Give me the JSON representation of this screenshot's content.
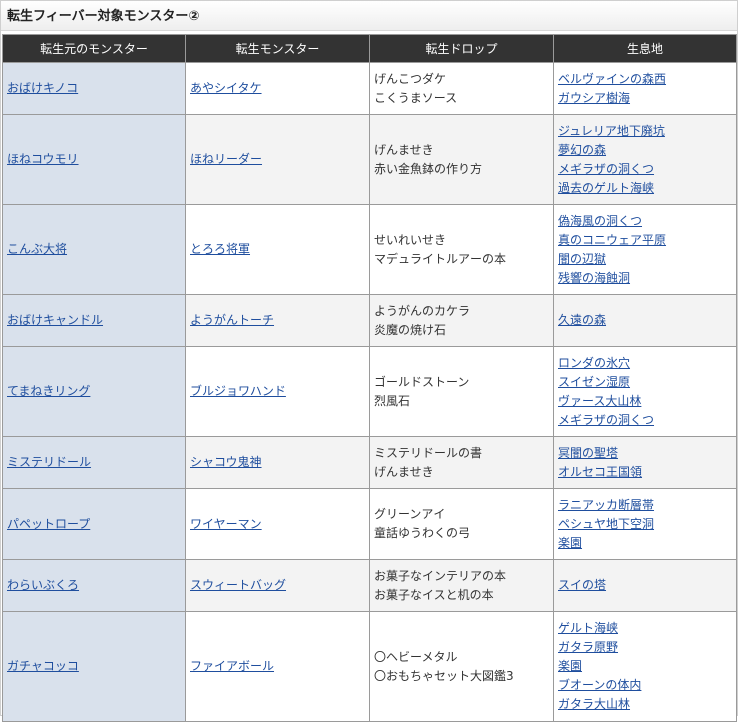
{
  "page": {
    "title": "転生フィーバー対象モンスター②"
  },
  "table": {
    "headers": [
      "転生元のモンスター",
      "転生モンスター",
      "転生ドロップ",
      "生息地"
    ],
    "rows": [
      {
        "origin": "おばけキノコ",
        "reborn": "あやシイタケ",
        "drops": [
          "げんこつダケ",
          "こくうまソース"
        ],
        "habitats": [
          "ベルヴァインの森西",
          "ガウシア樹海"
        ]
      },
      {
        "origin": "ほねコウモリ",
        "reborn": "ほねリーダー",
        "drops": [
          "げんませき",
          "赤い金魚鉢の作り方"
        ],
        "habitats": [
          "ジュレリア地下廃坑",
          "夢幻の森",
          "メギラザの洞くつ",
          "過去のゲルト海峡"
        ]
      },
      {
        "origin": "こんぶ大将",
        "reborn": "とろろ将軍",
        "drops": [
          "せいれいせき",
          "マデュライトルアーの本"
        ],
        "habitats": [
          "偽海風の洞くつ",
          "真のコニウェア平原",
          "闇の辺獄",
          "残響の海蝕洞"
        ]
      },
      {
        "origin": "おばけキャンドル",
        "reborn": "ようがんトーチ",
        "drops": [
          "ようがんのカケラ",
          "炎魔の焼け石"
        ],
        "habitats": [
          "久遠の森"
        ]
      },
      {
        "origin": "てまねきリング",
        "reborn": "ブルジョワハンド",
        "drops": [
          "ゴールドストーン",
          "烈風石"
        ],
        "habitats": [
          "ロンダの氷穴",
          "スイゼン湿原",
          "ヴァース大山林",
          "メギラザの洞くつ"
        ]
      },
      {
        "origin": "ミステリドール",
        "reborn": "シャコウ鬼神",
        "drops": [
          "ミステリドールの書",
          "げんませき"
        ],
        "habitats": [
          "冥闇の聖塔",
          "オルセコ王国領"
        ]
      },
      {
        "origin": "パペットロープ",
        "reborn": "ワイヤーマン",
        "drops": [
          "グリーンアイ",
          "童話ゆうわくの弓"
        ],
        "habitats": [
          "ラニアッカ断層帯",
          "ペシュヤ地下空洞",
          "楽園"
        ]
      },
      {
        "origin": "わらいぶくろ",
        "reborn": "スウィートバッグ",
        "drops": [
          "お菓子なインテリアの本",
          "お菓子なイスと机の本"
        ],
        "habitats": [
          "スイの塔"
        ]
      },
      {
        "origin": "ガチャコッコ",
        "reborn": "ファイアボール",
        "drops": [
          "〇ヘビーメタル",
          "〇おもちゃセット大図鑑3"
        ],
        "habitats": [
          "ゲルト海峡",
          "ガタラ原野",
          "楽園",
          "ブオーンの体内",
          "ガタラ大山林"
        ]
      }
    ]
  }
}
